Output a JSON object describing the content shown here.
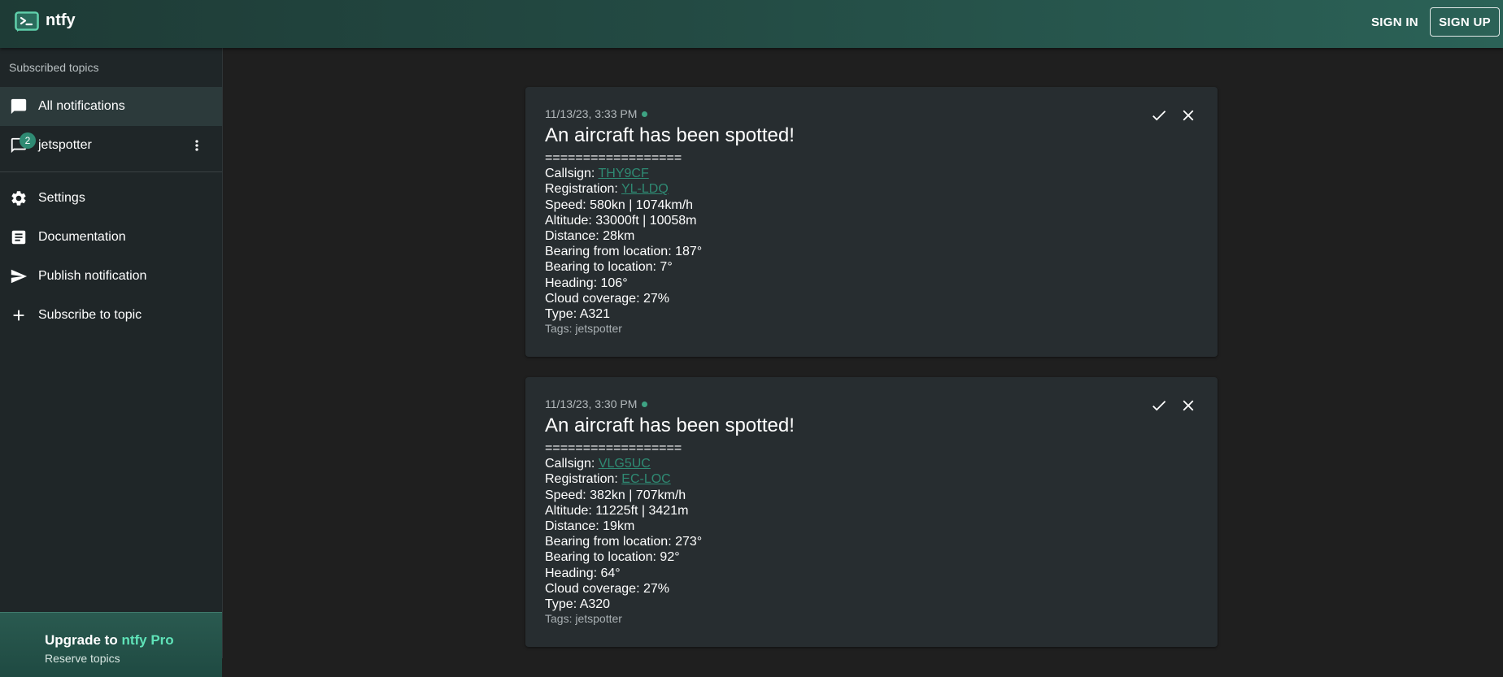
{
  "app": {
    "title": "ntfy",
    "signin_label": "SIGN IN",
    "signup_label": "SIGN UP"
  },
  "sidebar": {
    "heading": "Subscribed topics",
    "items": [
      {
        "label": "All notifications",
        "icon": "chat-bubble-icon",
        "active": true
      },
      {
        "label": "jetspotter",
        "icon": "chat-bubble-outline-icon",
        "badge": "2"
      },
      {
        "label": "Settings",
        "icon": "gear-icon"
      },
      {
        "label": "Documentation",
        "icon": "article-icon"
      },
      {
        "label": "Publish notification",
        "icon": "send-icon"
      },
      {
        "label": "Subscribe to topic",
        "icon": "plus-icon"
      }
    ],
    "upgrade": {
      "prefix": "Upgrade to ",
      "product": "ntfy Pro",
      "subtitle": "Reserve topics"
    }
  },
  "notifications": [
    {
      "date": "11/13/23, 3:33 PM",
      "title": "An aircraft has been spotted!",
      "separator": "==================",
      "callsign_label": "Callsign: ",
      "callsign": "THY9CF ",
      "registration_label": "Registration: ",
      "registration": "YL-LDQ",
      "speed": "Speed: 580kn | 1074km/h",
      "altitude": "Altitude: 33000ft | 10058m",
      "distance": "Distance: 28km",
      "bearing_from": "Bearing from location: 187°",
      "bearing_to": "Bearing to location: 7°",
      "heading": "Heading: 106°",
      "cloud": "Cloud coverage: 27%",
      "type": "Type: A321",
      "tags": "Tags: jetspotter"
    },
    {
      "date": "11/13/23, 3:30 PM",
      "title": "An aircraft has been spotted!",
      "separator": "==================",
      "callsign_label": "Callsign: ",
      "callsign": "VLG5UC ",
      "registration_label": "Registration: ",
      "registration": "EC-LOC",
      "speed": "Speed: 382kn | 707km/h",
      "altitude": "Altitude: 11225ft | 3421m",
      "distance": "Distance: 19km",
      "bearing_from": "Bearing from location: 273°",
      "bearing_to": "Bearing to location: 92°",
      "heading": "Heading: 64°",
      "cloud": "Cloud coverage: 27%",
      "type": "Type: A320",
      "tags": "Tags: jetspotter"
    }
  ],
  "colors": {
    "accent": "#2f8a73",
    "card": "#272d30",
    "sidebar": "#1f2628",
    "background": "#1f1f1f"
  }
}
